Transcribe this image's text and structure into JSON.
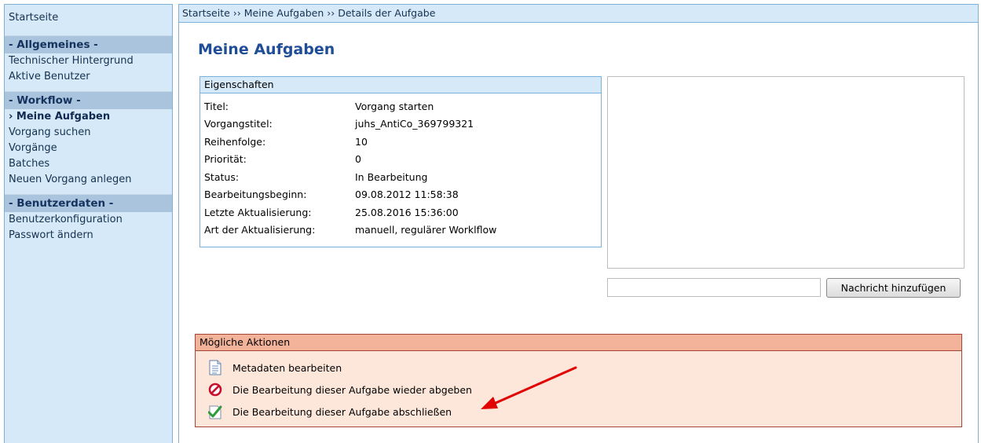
{
  "sidebar": {
    "home": "Startseite",
    "sections": [
      {
        "title": "- Allgemeines -",
        "items": [
          "Technischer Hintergrund",
          "Aktive Benutzer"
        ]
      },
      {
        "title": "- Workflow -",
        "items": [
          "› Meine Aufgaben",
          "Vorgang suchen",
          "Vorgänge",
          "Batches",
          "Neuen Vorgang anlegen"
        ]
      },
      {
        "title": "- Benutzerdaten -",
        "items": [
          "Benutzerkonfiguration",
          "Passwort ändern"
        ]
      }
    ]
  },
  "breadcrumb": "Startseite ›› Meine Aufgaben ›› Details der Aufgabe",
  "page_title": "Meine Aufgaben",
  "properties": {
    "header": "Eigenschaften",
    "rows": [
      {
        "key": "Titel:",
        "value": "Vorgang starten"
      },
      {
        "key": "Vorgangstitel:",
        "value": "juhs_AntiCo_369799321"
      },
      {
        "key": "Reihenfolge:",
        "value": "10"
      },
      {
        "key": "Priorität:",
        "value": "0"
      },
      {
        "key": "Status:",
        "value": "In Bearbeitung"
      },
      {
        "key": "Bearbeitungsbeginn:",
        "value": "09.08.2012 11:58:38"
      },
      {
        "key": "Letzte Aktualisierung:",
        "value": "25.08.2016 15:36:00"
      },
      {
        "key": "Art der Aktualisierung:",
        "value": "manuell, regulärer Worklflow"
      }
    ]
  },
  "message": {
    "input_value": "",
    "button_label": "Nachricht hinzufügen"
  },
  "actions": {
    "header": "Mögliche Aktionen",
    "items": [
      {
        "label": "Metadaten bearbeiten",
        "icon": "document-icon"
      },
      {
        "label": "Die Bearbeitung dieser Aufgabe wieder abgeben",
        "icon": "forbidden-icon"
      },
      {
        "label": "Die Bearbeitung dieser Aufgabe abschließen",
        "icon": "checkmark-icon"
      }
    ]
  },
  "colors": {
    "sidebar_bg": "#d6e9f9",
    "section_head_bg": "#a9c4dc",
    "title_blue": "#1f4e96",
    "actions_bg": "#fde7db",
    "actions_head_bg": "#f3b39a",
    "annotation_arrow": "#e00000"
  }
}
